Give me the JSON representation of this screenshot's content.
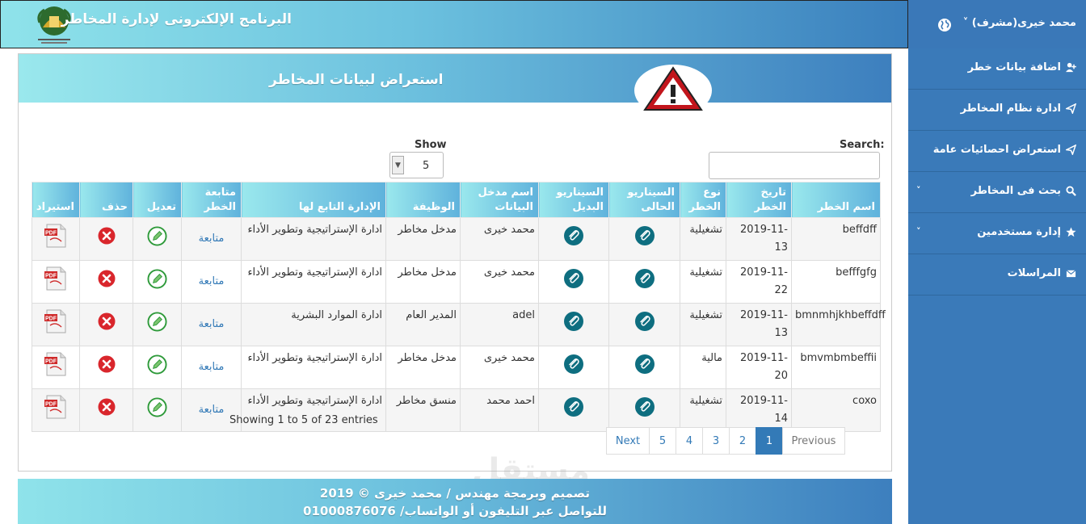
{
  "header": {
    "app_title": "البرنامج الإلكترونى لإدارة المخاطر",
    "user_menu": "محمد خيرى(مشرف) ˅"
  },
  "sidebar": {
    "items": [
      {
        "label": "اضافة بيانات خطر",
        "icon": "user-plus-icon"
      },
      {
        "label": "ادارة نظام المخاطر",
        "icon": "send-icon"
      },
      {
        "label": "استعراض احصائيات عامة",
        "icon": "send-icon"
      },
      {
        "label": "بحث فى المخاطر",
        "icon": "search-icon",
        "chevron": "˅"
      },
      {
        "label": "إدارة مستخدمين",
        "icon": "star-icon",
        "chevron": "˅"
      },
      {
        "label": "المراسلات",
        "icon": "envelope-icon"
      }
    ]
  },
  "main": {
    "title": "استعراض لبيانات المخاطر",
    "show_label": "Show",
    "show_value": "5",
    "search_label": "Search:",
    "columns": [
      "اسم الخطر",
      "تاريخ الخطر",
      "نوع الخطر",
      "السيناريو الحالى",
      "السيناريو البديل",
      "اسم مدخل البيانات",
      "الوظيفة",
      "الإدارة التابع لها",
      "متابعة الخطر",
      "تعديل",
      "حذف",
      "استيراد"
    ],
    "rows": [
      {
        "name": "beffdff",
        "date": "2019-11-13",
        "type": "تشغيلية",
        "entered_by": "محمد خيرى",
        "job": "مدخل مخاطر",
        "dept": "ادارة الإستراتيجية وتطوير الأداء",
        "follow": "متابعة"
      },
      {
        "name": "befffgfg",
        "date": "2019-11-22",
        "type": "تشغيلية",
        "entered_by": "محمد خيرى",
        "job": "مدخل مخاطر",
        "dept": "ادارة الإستراتيجية وتطوير الأداء",
        "follow": "متابعة"
      },
      {
        "name": "bmnmhjkhbeffdff",
        "date": "2019-11-13",
        "type": "تشغيلية",
        "entered_by": "adel",
        "job": "المدير العام",
        "dept": "ادارة الموارد البشرية",
        "follow": "متابعة"
      },
      {
        "name": "bmvmbmbeffii",
        "date": "2019-11-20",
        "type": "مالية",
        "entered_by": "محمد خيرى",
        "job": "مدخل مخاطر",
        "dept": "ادارة الإستراتيجية وتطوير الأداء",
        "follow": "متابعة"
      },
      {
        "name": "coxo",
        "date": "2019-11-14",
        "type": "تشغيلية",
        "entered_by": "احمد محمد",
        "job": "منسق مخاطر",
        "dept": "ادارة الإستراتيجية وتطوير الأداء",
        "follow": "متابعة"
      }
    ],
    "info": "Showing 1 to 5 of 23 entries",
    "pagination": {
      "previous": "Previous",
      "pages": [
        "1",
        "2",
        "3",
        "4",
        "5"
      ],
      "active_page": "1",
      "next": "Next"
    }
  },
  "footer": {
    "line1": "تصميم وبرمجة مهندس / محمد خيرى © 2019",
    "line2": "للتواصل عبر التليفون أو الواتساب/ 01000876076"
  },
  "watermark": "مستقل",
  "colors": {
    "sidebar": "#3a7ab9",
    "accent": "#337ab7",
    "clip": "#0e6e80",
    "delete": "#d9262c",
    "edit": "#2e9a3a"
  }
}
